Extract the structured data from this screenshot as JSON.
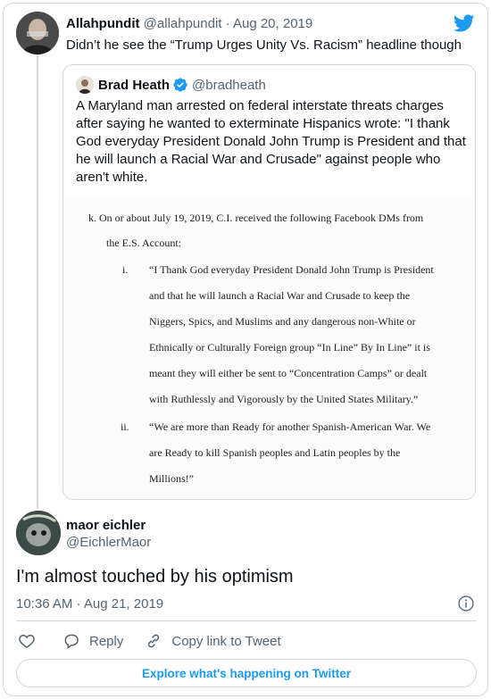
{
  "reply_tweet": {
    "author_name": "Allahpundit",
    "author_handle": "@allahpundit",
    "date": "Aug 20, 2019",
    "separator": " · ",
    "text": "Didn’t he see the “Trump Urges Unity Vs. Racism” headline though"
  },
  "quoted_tweet": {
    "author_name": "Brad Heath",
    "author_handle": "@bradheath",
    "text": "A Maryland man arrested on federal interstate threats charges after saying he wanted to exterminate Hispanics wrote: \"I thank God everyday President Donald John Trump is President and that he will launch a Racial War and Crusade\" against people who aren't white.",
    "document_lines": [
      "k.  On or about July 19, 2019, C.I. received the following Facebook DMs from",
      "the E.S. Account:",
      "i.",
      "“I Thank God everyday President Donald John Trump is President",
      "and that he will launch a Racial War and Crusade to keep the",
      "Niggers, Spics, and Muslims and any dangerous non-White or",
      "Ethnically or Culturally Foreign group “In Line” By In Line” it is",
      "meant they will either be sent to “Concentration Camps” or dealt",
      "with Ruthlessly and Vigorously by the United States Military.”",
      "ii.",
      "“We are more than Ready for another Spanish-American War.  We",
      "are Ready to kill Spanish peoples and Latin peoples by the",
      "Millions!”"
    ]
  },
  "main_tweet": {
    "author_name": "maor eichler",
    "author_handle": "@EichlerMaor",
    "text": "I'm almost touched by his optimism",
    "timestamp": "10:36 AM · Aug 21, 2019"
  },
  "actions": {
    "reply_label": "Reply",
    "copy_link_label": "Copy link to Tweet"
  },
  "explore_label": "Explore what's happening on Twitter",
  "icons": {
    "brand": "twitter-bird-icon",
    "verified": "verified-badge-icon",
    "info": "info-icon",
    "like": "heart-icon",
    "reply": "reply-bubble-icon",
    "copy_link": "link-icon"
  },
  "colors": {
    "accent": "#1d9bf0",
    "text": "#0f1419",
    "secondary": "#536471",
    "border": "#cfd9de"
  }
}
